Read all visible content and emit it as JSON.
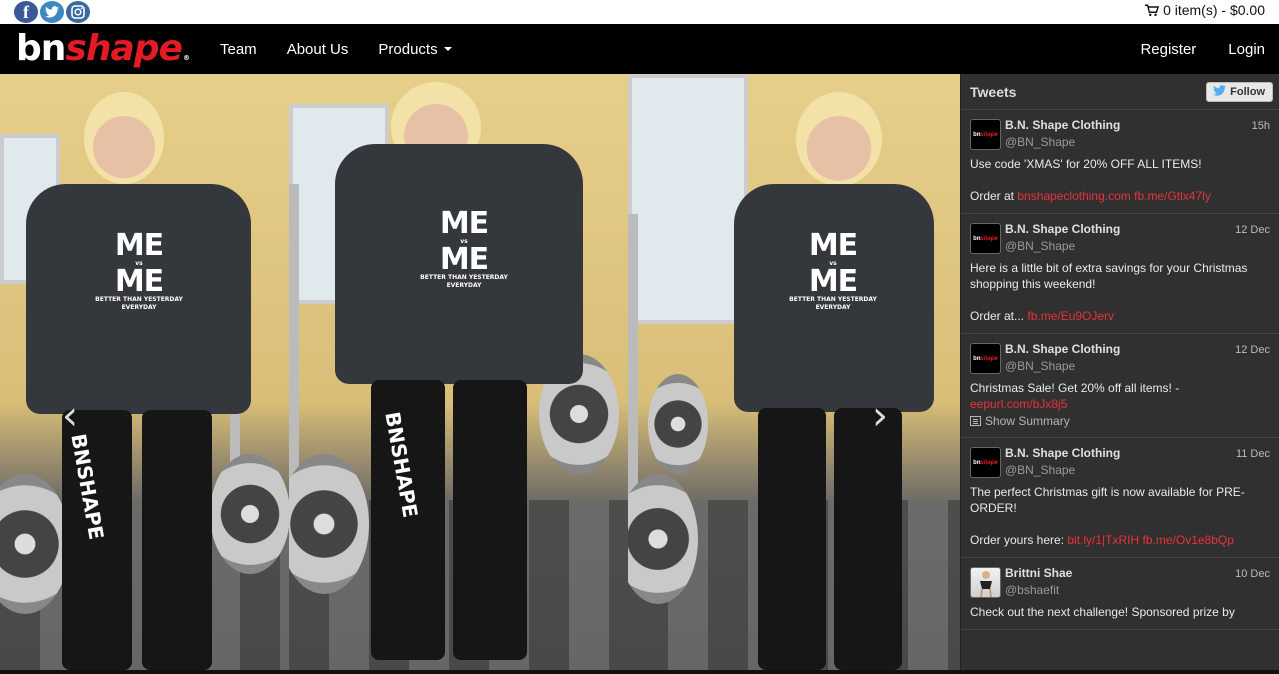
{
  "social": {
    "facebook_glyph": "f",
    "twitter_glyph": "t",
    "instagram_glyph": "◎"
  },
  "cart": {
    "label": "0 item(s) - $0.00"
  },
  "brand": {
    "part1": "bn",
    "part2": "shape",
    "reg": "®",
    "colors": {
      "white": "#ffffff",
      "red": "#e31b23"
    }
  },
  "nav": {
    "left": [
      {
        "label": "Team"
      },
      {
        "label": "About Us"
      },
      {
        "label": "Products"
      }
    ],
    "right": [
      {
        "label": "Register"
      },
      {
        "label": "Login"
      }
    ]
  },
  "carousel": {
    "prev_glyph": "‹",
    "next_glyph": "›",
    "shirt_big_text": "ME",
    "shirt_vs_text": "vs",
    "shirt_tagline": "BETTER THAN YESTERDAY",
    "shirt_everyday": "EVERYDAY",
    "leg_logo": "BNSHAPE"
  },
  "tweets": {
    "title": "Tweets",
    "follow_label": "Follow",
    "items": [
      {
        "name": "B.N. Shape Clothing",
        "handle": "@BN_Shape",
        "date": "15h",
        "avatar_text1": "bn",
        "avatar_text2": "shape",
        "line1": "Use code 'XMAS' for 20% OFF ALL ITEMS!",
        "line2_prefix": "Order at ",
        "link1": "bnshapeclothing.com",
        "link2": "fb.me/Gtlx47ly"
      },
      {
        "name": "B.N. Shape Clothing",
        "handle": "@BN_Shape",
        "date": "12 Dec",
        "avatar_text1": "bn",
        "avatar_text2": "shape",
        "line1": "Here is a little bit of extra savings for your Christmas shopping this weekend!",
        "line2_prefix": "Order at... ",
        "link1": "fb.me/Eu9OJerv"
      },
      {
        "name": "B.N. Shape Clothing",
        "handle": "@BN_Shape",
        "date": "12 Dec",
        "avatar_text1": "bn",
        "avatar_text2": "shape",
        "line1": "Christmas Sale! Get 20% off all items! -",
        "link1": "eepurl.com/bJx8j5",
        "summary": "Show Summary"
      },
      {
        "name": "B.N. Shape Clothing",
        "handle": "@BN_Shape",
        "date": "11 Dec",
        "avatar_text1": "bn",
        "avatar_text2": "shape",
        "line1": "The perfect Christmas gift is now available for PRE-ORDER!",
        "line2_prefix": "Order yours here:  ",
        "link1": "bit.ly/1|TxRIH",
        "link2": "fb.me/Ov1e8bQp"
      },
      {
        "name": "Brittni Shae",
        "handle": "@bshaefit",
        "date": "10 Dec",
        "line1": "Check out the next challenge! Sponsored prize by"
      }
    ]
  }
}
